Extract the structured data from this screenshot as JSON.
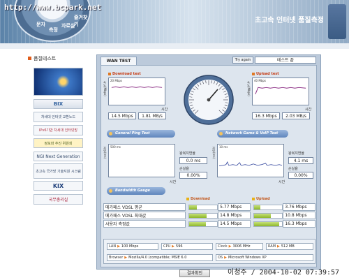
{
  "header": {
    "url": "http://www.bcpark.net",
    "title": "초고속 인터넷 품질측정",
    "globe_labels": [
      "문자",
      "측정",
      "자료실",
      "즐겨찾기"
    ]
  },
  "sidebar": {
    "section_title": "품질테스트",
    "banners": [
      {
        "name": "banner-main",
        "label": ""
      },
      {
        "name": "banner-bix",
        "label": "BIX"
      },
      {
        "name": "banner-exchange",
        "label": "차세대 인터넷 교환노드"
      },
      {
        "name": "banner-ipv6",
        "label": "IPv6기반 차세대 인터넷망"
      },
      {
        "name": "banner-committee",
        "label": "정보화 추진 위원회"
      },
      {
        "name": "banner-ngi",
        "label": "NGI Next Generation"
      },
      {
        "name": "banner-tech",
        "label": "초고속 국가망 기술지원 시스템"
      },
      {
        "name": "banner-kix",
        "label": "KIX"
      },
      {
        "name": "banner-pm",
        "label": "국무총리실"
      }
    ]
  },
  "panel": {
    "tab": "WAN TEST",
    "try_again": "Try again",
    "status": "테스트 끝",
    "download": {
      "title": "Download test",
      "axis": "속도(Mbps)",
      "scale": "20 Mbps",
      "time_label": "시간",
      "mbps": "14.5 Mbps",
      "mbs": "1.81 MB/s"
    },
    "upload": {
      "title": "Upload test",
      "axis": "속도(Mbps)",
      "scale": "40 Mbps",
      "time_label": "시간",
      "mbps": "16.3 Mbps",
      "mbs": "2.03 MB/s"
    },
    "ping_header": "General Ping Test",
    "voip_header": "Network Game & VoIP Test",
    "ping": {
      "axis": "지연(ms)",
      "scale": "500 ms",
      "time_label": "시간",
      "rtt_label": "왕복지연율",
      "rtt": "0.0 ms",
      "loss_label": "손실율",
      "loss": "0.00%"
    },
    "voip": {
      "axis": "지연(ms)",
      "scale": "10 ms",
      "time_label": "시간",
      "rtt_label": "왕복지연율",
      "rtt": "4.1 ms",
      "loss_label": "손실율",
      "loss": "0.00%"
    },
    "bandwidth_header": "Bandwidth Gauge",
    "results": {
      "download_label": "Download",
      "upload_label": "Upload",
      "rows": [
        {
          "label": "메가패스 VDSL 평균",
          "down": "5.77 Mbps",
          "down_fill": 0.27,
          "up": "3.76 Mbps",
          "up_fill": 0.22
        },
        {
          "label": "메가패스 VDSL 최대값",
          "down": "14.8 Mbps",
          "down_fill": 0.62,
          "up": "10.8 Mbps",
          "up_fill": 0.6
        },
        {
          "label": "사용자 측정값",
          "down": "14.5 Mbps",
          "down_fill": 0.61,
          "up": "16.3 Mbps",
          "up_fill": 0.9
        }
      ]
    },
    "system": {
      "lan_label": "LAN",
      "lan": "100 Mbps",
      "cpu_label": "CPU",
      "cpu": "596",
      "clock_label": "Clock",
      "clock": "3006 MHz",
      "ram_label": "RAM",
      "ram": "512 MB",
      "browser_label": "Browser",
      "browser": "Mozilla/4.0 (compatible; MSIE 6.0",
      "os_label": "OS",
      "os": "Microsoft Windows XP"
    },
    "confirm": "결과확인"
  },
  "footer": {
    "stamp": "이청주 / 2004-10-02 07:39:57"
  }
}
